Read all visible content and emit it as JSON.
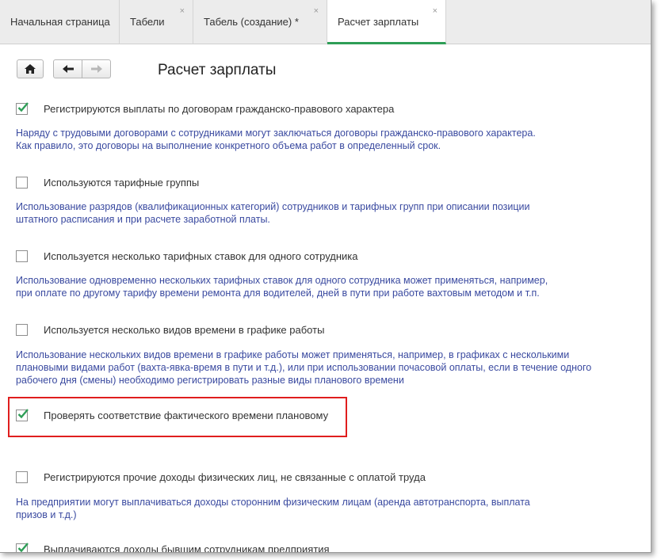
{
  "tabs": [
    {
      "label": "Начальная страница",
      "closable": false,
      "active": false
    },
    {
      "label": "Табели",
      "closable": true,
      "active": false
    },
    {
      "label": "Табель (создание) *",
      "closable": true,
      "active": false
    },
    {
      "label": "Расчет зарплаты",
      "closable": true,
      "active": true
    }
  ],
  "close_glyph": "×",
  "page_title": "Расчет зарплаты",
  "options": [
    {
      "label": "Регистрируются выплаты по договорам гражданско-правового характера",
      "checked": true,
      "description": [
        "Наряду с трудовыми договорами с сотрудниками могут заключаться договоры гражданско-правового характера.",
        "Как правило, это договоры на выполнение конкретного объема работ в определенный срок."
      ]
    },
    {
      "label": "Используются тарифные группы",
      "checked": false,
      "description": [
        "Использование разрядов (квалификационных категорий) сотрудников и тарифных групп при описании позиции",
        "штатного расписания и при расчете заработной платы."
      ]
    },
    {
      "label": "Используется несколько тарифных ставок для одного сотрудника",
      "checked": false,
      "description": [
        "Использование одновременно нескольких тарифных ставок для одного сотрудника может применяться, например,",
        "при оплате по другому тарифу времени ремонта для водителей, дней в пути при работе вахтовым методом и т.п."
      ]
    },
    {
      "label": "Используется несколько видов времени в графике работы",
      "checked": false,
      "description": [
        "Использование нескольких видов времени в графике работы может применяться, например, в графиках с несколькими",
        "плановыми видами работ (вахта-явка-время в пути и т.д.), или при использовании почасовой оплаты, если в течение одного",
        "рабочего дня (смены) необходимо регистрировать разные виды планового времени"
      ]
    },
    {
      "label": "Проверять соответствие фактического времени плановому",
      "checked": true,
      "highlighted": true,
      "description": []
    },
    {
      "label": "Регистрируются прочие доходы физических лиц, не связанные с оплатой труда",
      "checked": false,
      "description": [
        "На предприятии могут выплачиваться доходы сторонним физическим лицам (аренда автотранспорта, выплата",
        "призов и т.д.)"
      ]
    },
    {
      "label": "Выплачиваются доходы бывшим сотрудникам предприятия",
      "checked": true,
      "description": []
    }
  ],
  "colors": {
    "accent_tab": "#2e9e57",
    "description_text": "#3a4aa0",
    "highlight_border": "#e01e1e",
    "check_mark": "#2e9e57"
  },
  "icons": {
    "home": "home-icon",
    "back": "arrow-left-icon",
    "forward": "arrow-right-icon",
    "check": "checkmark-icon"
  }
}
